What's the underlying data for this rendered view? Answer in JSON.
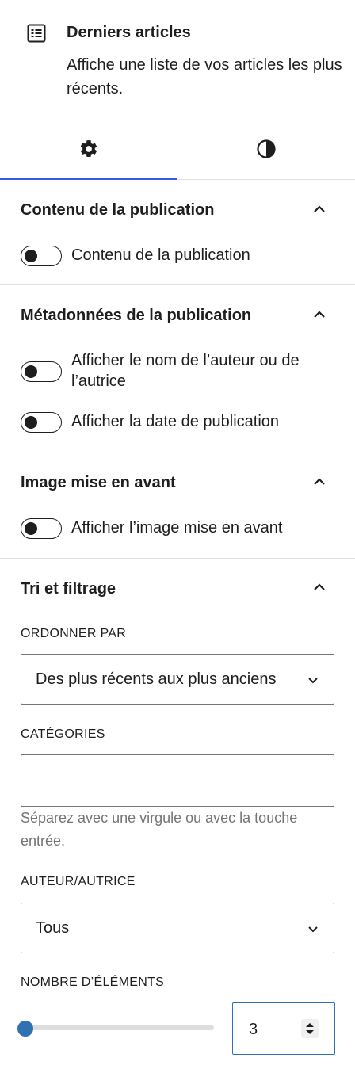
{
  "block": {
    "icon": "list-icon",
    "title": "Derniers articles",
    "description": "Affiche une liste de vos articles les plus récents."
  },
  "tabs": [
    {
      "icon": "gear-icon",
      "active": true
    },
    {
      "icon": "contrast-icon",
      "active": false
    }
  ],
  "panels": {
    "content": {
      "title": "Contenu de la publication",
      "toggles": [
        {
          "label": "Contenu de la publication",
          "on": false
        }
      ]
    },
    "meta": {
      "title": "Métadonnées de la publication",
      "toggles": [
        {
          "label": "Afficher le nom de l’auteur ou de l’autrice",
          "on": false
        },
        {
          "label": "Afficher la date de publication",
          "on": false
        }
      ]
    },
    "featured": {
      "title": "Image mise en avant",
      "toggles": [
        {
          "label": "Afficher l’image mise en avant",
          "on": false
        }
      ]
    },
    "sorting": {
      "title": "Tri et filtrage",
      "order_label": "ORDONNER PAR",
      "order_value": "Des plus récents aux plus anciens",
      "categories_label": "CATÉGORIES",
      "categories_value": "",
      "categories_help": "Séparez avec une virgule ou avec la touche entrée.",
      "author_label": "AUTEUR/AUTRICE",
      "author_value": "Tous",
      "count_label": "NOMBRE D’ÉLÉMENTS",
      "count_value": "3",
      "count_slider_fraction": 0.0
    }
  },
  "colors": {
    "accent": "#3858e9",
    "slider": "#2f71b2",
    "text": "#1e1e1e",
    "muted": "#757575",
    "divider": "#e0e0e0"
  }
}
